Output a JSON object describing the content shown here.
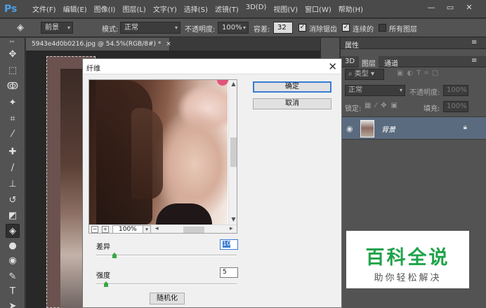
{
  "app": {
    "logo": "Ps"
  },
  "menu": [
    "文件(F)",
    "编辑(E)",
    "图像(I)",
    "图层(L)",
    "文字(Y)",
    "选择(S)",
    "滤镜(T)",
    "3D(D)",
    "视图(V)",
    "窗口(W)",
    "帮助(H)"
  ],
  "window_controls": {
    "minimize": "—",
    "restore": "▭",
    "close": "✕"
  },
  "options": {
    "fill_source": "前景",
    "mode_label": "模式:",
    "mode_value": "正常",
    "opacity_label": "不透明度:",
    "opacity_value": "100%",
    "tolerance_label": "容差:",
    "tolerance_value": "32",
    "antialias_label": "消除锯齿",
    "antialias_checked": true,
    "contiguous_label": "连续的",
    "contiguous_checked": true,
    "all_layers_label": "所有图层",
    "all_layers_checked": false
  },
  "document": {
    "tab_title": "5943e4d0b0216.jpg @ 54.5%(RGB/8#) *",
    "tab_close": "×"
  },
  "tools": [
    {
      "name": "move-icon",
      "glyph": "✥"
    },
    {
      "name": "marquee-icon",
      "glyph": "⬚"
    },
    {
      "name": "lasso-icon",
      "glyph": "ↂ"
    },
    {
      "name": "magic-wand-icon",
      "glyph": "✦"
    },
    {
      "name": "crop-icon",
      "glyph": "⌗"
    },
    {
      "name": "eyedropper-icon",
      "glyph": "⁄"
    },
    {
      "name": "healing-icon",
      "glyph": "✚"
    },
    {
      "name": "brush-icon",
      "glyph": "/"
    },
    {
      "name": "stamp-icon",
      "glyph": "⊥"
    },
    {
      "name": "history-brush-icon",
      "glyph": "↺"
    },
    {
      "name": "eraser-icon",
      "glyph": "◩"
    },
    {
      "name": "paint-bucket-icon",
      "glyph": "◈"
    },
    {
      "name": "blur-icon",
      "glyph": "●"
    },
    {
      "name": "dodge-icon",
      "glyph": "◉"
    },
    {
      "name": "pen-icon",
      "glyph": "✎"
    },
    {
      "name": "type-icon",
      "glyph": "T"
    },
    {
      "name": "path-select-icon",
      "glyph": "➤"
    }
  ],
  "panels": {
    "properties_tab": "属性",
    "tabs": [
      "3D",
      "图层",
      "通道"
    ],
    "kind_label": "类型",
    "blend_mode": "正常",
    "opacity_label": "不透明度:",
    "opacity_value": "100%",
    "lock_label": "锁定:",
    "fill_label": "填充:",
    "fill_value": "100%",
    "layer_name": "背景"
  },
  "dialog": {
    "title": "纤维",
    "close": "✕",
    "ok_label": "确定",
    "cancel_label": "取消",
    "zoom_value": "100%",
    "zoom_minus": "−",
    "zoom_plus": "+",
    "variance_label": "差异",
    "variance_value": "10",
    "variance_fraction": 0.13,
    "strength_label": "强度",
    "strength_value": "5",
    "strength_fraction": 0.07,
    "randomize_label": "随机化"
  },
  "watermark": {
    "title": "百科全说",
    "subtitle": "助你轻松解决",
    "color": "#1fa34a"
  }
}
